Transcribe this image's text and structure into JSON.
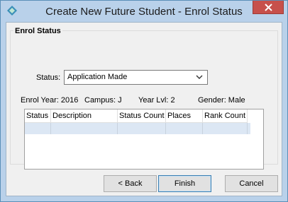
{
  "window": {
    "title": "Create New Future Student - Enrol Status"
  },
  "group": {
    "title": "Enrol Status"
  },
  "status": {
    "label": "Status:",
    "value": "Application Made"
  },
  "info": {
    "enrol_year": "Enrol Year: 2016",
    "campus": "Campus: J",
    "year_lvl": "Year Lvl: 2",
    "gender": "Gender: Male"
  },
  "grid": {
    "columns": [
      "Status",
      "Description",
      "Status Count",
      "Places",
      "Rank Count"
    ]
  },
  "buttons": {
    "back": "< Back",
    "finish": "Finish",
    "cancel": "Cancel"
  },
  "colors": {
    "title_bar": "#b9d1ea",
    "close": "#c7504b",
    "row_selected": "#dce7f4"
  }
}
